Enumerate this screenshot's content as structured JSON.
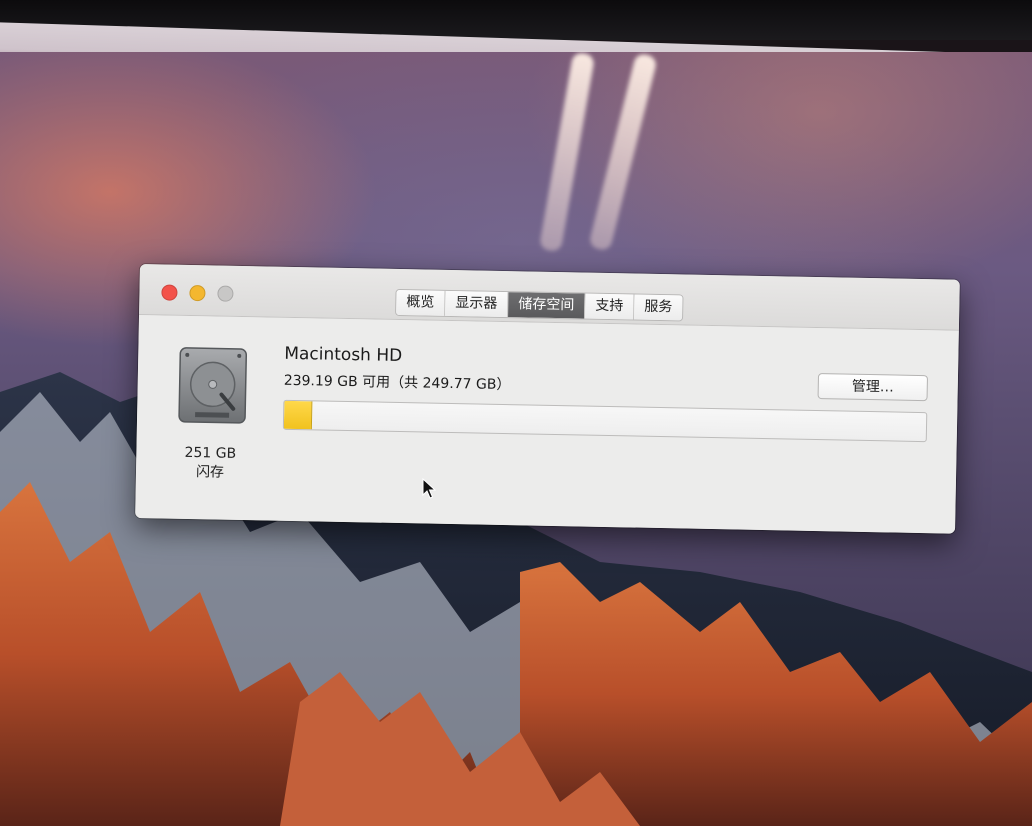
{
  "window": {
    "tabs": [
      {
        "label": "概览",
        "active": false
      },
      {
        "label": "显示器",
        "active": false
      },
      {
        "label": "储存空间",
        "active": true
      },
      {
        "label": "支持",
        "active": false
      },
      {
        "label": "服务",
        "active": false
      }
    ]
  },
  "storage": {
    "drive_size": "251 GB",
    "drive_type": "闪存",
    "volume_name": "Macintosh HD",
    "available_text": "239.19 GB 可用（共 249.77 GB）",
    "manage_label": "管理…",
    "used_fraction": 0.042,
    "used_color": "#f4c928"
  },
  "colors": {
    "close": "#f3524a",
    "minimize": "#f4b72f",
    "zoom": "#c8c7c6",
    "active_tab": "#5f5f61"
  },
  "icons": [
    "hard-drive-icon",
    "pointer-cursor-icon"
  ]
}
